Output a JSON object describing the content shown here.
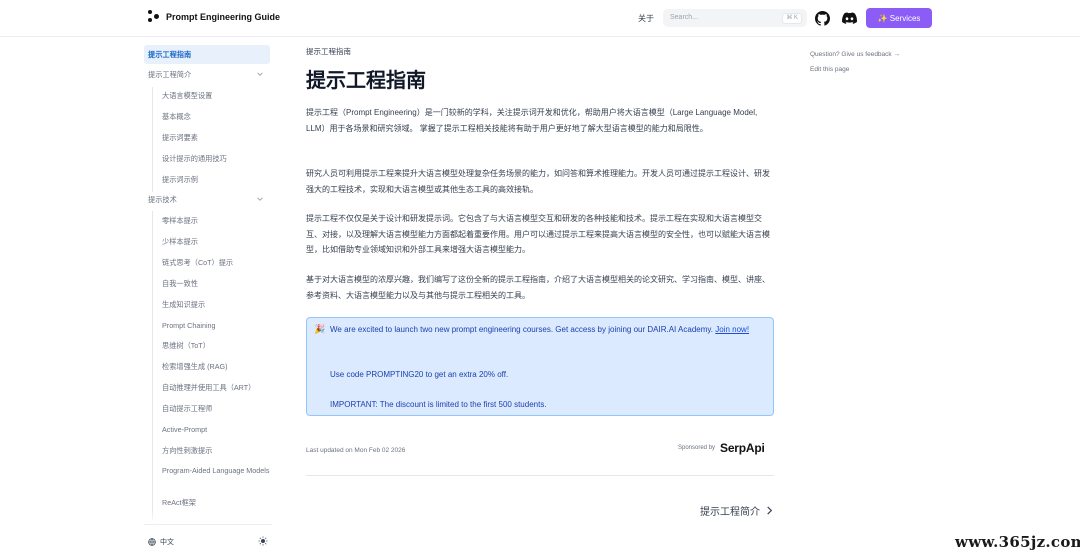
{
  "header": {
    "logo_title": "Prompt Engineering Guide",
    "nav_about": "关于",
    "search_placeholder": "Search...",
    "search_shortcut": "⌘ K",
    "services_label": "✨ Services",
    "services_color": "#8b5cf6"
  },
  "sidebar": {
    "items": [
      {
        "label": "提示工程指南",
        "active": true
      },
      {
        "label": "提示工程简介",
        "expandable": true
      },
      {
        "label": "大语言模型设置"
      },
      {
        "label": "基本概念"
      },
      {
        "label": "提示词要素"
      },
      {
        "label": "设计提示的通用技巧"
      },
      {
        "label": "提示词示例"
      },
      {
        "label": "提示技术",
        "expandable": true
      },
      {
        "label": "零样本提示"
      },
      {
        "label": "少样本提示"
      },
      {
        "label": "链式思考（CoT）提示"
      },
      {
        "label": "自我一致性"
      },
      {
        "label": "生成知识提示"
      },
      {
        "label": "Prompt Chaining"
      },
      {
        "label": "思维树（ToT）"
      },
      {
        "label": "检索增强生成 (RAG)"
      },
      {
        "label": "自动推理并使用工具（ART）"
      },
      {
        "label": "自动提示工程师"
      },
      {
        "label": "Active-Prompt"
      },
      {
        "label": "方向性刺激提示"
      },
      {
        "label": "Program-Aided Language Models"
      },
      {
        "label": "ReAct框架"
      }
    ],
    "footer_lang": "中文"
  },
  "main": {
    "breadcrumb": "提示工程指南",
    "title": "提示工程指南",
    "paragraphs": [
      "提示工程（Prompt Engineering）是一门较新的学科，关注提示词开发和优化，帮助用户将大语言模型（Large Language Model, LLM）用于各场景和研究领域。 掌握了提示工程相关技能将有助于用户更好地了解大型语言模型的能力和局限性。",
      "研究人员可利用提示工程来提升大语言模型处理复杂任务场景的能力，如问答和算术推理能力。开发人员可通过提示工程设计、研发强大的工程技术，实现和大语言模型或其他生态工具的高效接轨。",
      "提示工程不仅仅是关于设计和研发提示词。它包含了与大语言模型交互和研发的各种技能和技术。提示工程在实现和大语言模型交互、对接，以及理解大语言模型能力方面都起着重要作用。用户可以通过提示工程来提高大语言模型的安全性，也可以赋能大语言模型，比如借助专业领域知识和外部工具来增强大语言模型能力。",
      "基于对大语言模型的浓厚兴趣，我们编写了这份全新的提示工程指南，介绍了大语言模型相关的论文研究、学习指南、模型、讲座、参考资料、大语言模型能力以及与其他与提示工程相关的工具。"
    ],
    "callout": {
      "emoji": "🎉",
      "line1": "We are excited to launch two new prompt engineering courses. Get access by joining our DAIR.AI Academy.",
      "link": "Join now!",
      "line2": "Use code PROMPTING20 to get an extra 20% off.",
      "line3": "IMPORTANT: The discount is limited to the first 500 students."
    },
    "last_updated": "Last updated on Mon Feb 02 2026",
    "sponsored_by": "Sponsored by",
    "sponsor_name": "SerpApi",
    "next_page": "提示工程简介"
  },
  "toc": {
    "feedback": "Question? Give us feedback →",
    "edit": "Edit this page"
  },
  "watermark": "www.365jz.com"
}
